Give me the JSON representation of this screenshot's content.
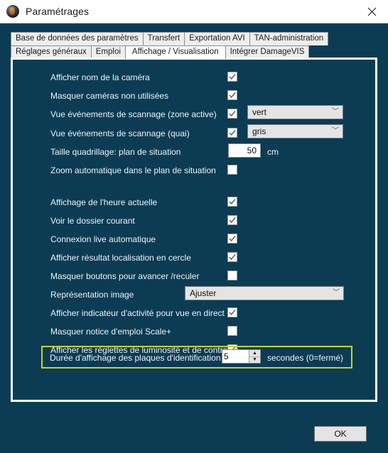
{
  "window": {
    "title": "Paramétrages",
    "icon": "app-globe-icon",
    "close_label": "✕",
    "bg_color": "#0b3c54",
    "highlight_color": "#c8d419"
  },
  "tabs": {
    "row1": [
      {
        "label": "Base de données des paramètres",
        "active": false
      },
      {
        "label": "Transfert",
        "active": false
      },
      {
        "label": "Exportation AVI",
        "active": false
      },
      {
        "label": "TAN-administration",
        "active": false
      }
    ],
    "row2": [
      {
        "label": "Réglages généraux",
        "active": false
      },
      {
        "label": "Emploi",
        "active": false
      },
      {
        "label": "Affichage / Visualisation",
        "active": true
      },
      {
        "label": "Intégrer DamageVIS",
        "active": false
      }
    ]
  },
  "settings": [
    {
      "label": "Afficher nom de la caméra",
      "control": "checkbox",
      "checked": true
    },
    {
      "label": "Masquer caméras non utilisées",
      "control": "checkbox",
      "checked": true
    },
    {
      "label": "Vue événements de scannage (zone active)",
      "control": "checkbox",
      "checked": true,
      "combo": "vert"
    },
    {
      "label": "Vue événements de scannage (quai)",
      "control": "checkbox",
      "checked": true,
      "combo": "gris"
    },
    {
      "label": "Taille quadrillage: plan de situation",
      "control": "text",
      "value": "50",
      "unit": "cm"
    },
    {
      "label": "Zoom automatique dans le plan de situation",
      "control": "checkbox",
      "checked": false
    },
    {
      "label": "Affichage de l'heure actuelle",
      "control": "checkbox",
      "checked": true
    },
    {
      "label": "Voir le dossier courant",
      "control": "checkbox",
      "checked": true
    },
    {
      "label": "Connexion live automatique",
      "control": "checkbox",
      "checked": true
    },
    {
      "label": "Afficher résultat localisation en cercle",
      "control": "checkbox",
      "checked": true
    },
    {
      "label": "Masquer boutons pour avancer /reculer",
      "control": "checkbox",
      "checked": false
    },
    {
      "label": "Représentation image",
      "control": "combo",
      "combo": "Ajuster"
    },
    {
      "label": "Afficher indicateur d'activité  pour vue en direct",
      "control": "checkbox",
      "checked": true
    },
    {
      "label": "Masquer notice d'emploi Scale+",
      "control": "checkbox",
      "checked": false
    },
    {
      "label": "Afficher les réglettes de luminosité et de contraste",
      "control": "checkbox",
      "checked": true
    },
    {
      "label": "Durée d'affichage des plaques d'identification reconnu",
      "control": "spinner",
      "value": "5",
      "suffix": "secondes (0=fermé)",
      "highlighted": true
    }
  ],
  "spinner": {
    "up_glyph": "▲",
    "down_glyph": "▼"
  },
  "footer": {
    "ok_label": "OK"
  }
}
